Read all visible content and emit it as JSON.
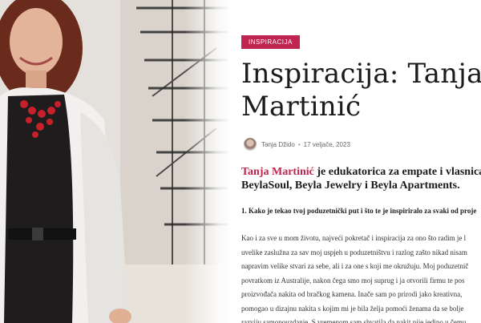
{
  "article": {
    "category": "INSPIRACIJA",
    "title_line1": "Inspiracija: Tanja",
    "title_line2": "Martinić",
    "author": "Tanja Džido",
    "separator": "•",
    "date": "17 veljače, 2023",
    "lead_name": "Tanja Martinić",
    "lead_rest_line1": " je edukatorica za empate i vlasnica us",
    "lead_line2": "BeylaSoul, Beyla Jewelry i Beyla Apartments.",
    "question1": "1. Kako je tekao tvoj poduzetnički put i što te je inspiriralo za svaki od proje",
    "body": [
      "Kao i za sve u mom životu, najveći pokretač i inspiracija za ono što radim je l",
      "uvelike zaslužna za sav moj uspjeh u poduzetništvu i razlog zašto nikad nisam",
      "napravim velike stvari za sebe, ali i za one s koji me okružuju. Moj poduzetnič",
      "povratkom iz Australije, nakon čega smo moj suprug i ja otvorili firmu te pos",
      "proizvođača nakita od bračkog kamena. Inače sam po prirodi jako kreativna,",
      "pomogao u dizajnu nakita s kojim mi je bila želja pomoći ženama da se bolje",
      "razviju samopouzdanje. S vremenom sam shvatila da nakit nije jedino u čemu"
    ]
  },
  "colors": {
    "accent": "#c0254f",
    "title": "#1b1b1b"
  },
  "icons": {
    "avatar": "author-avatar"
  }
}
